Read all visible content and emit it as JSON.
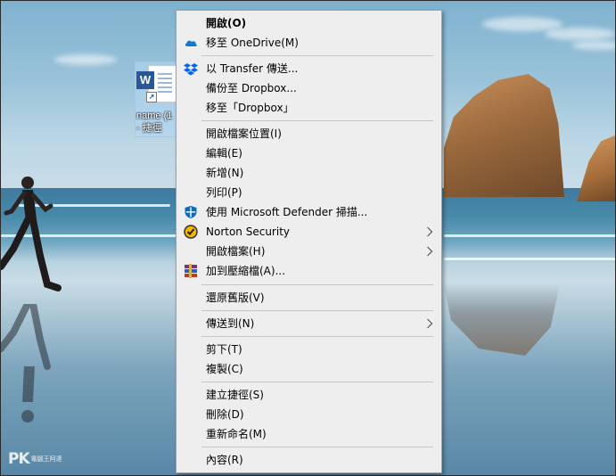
{
  "desktop": {
    "icon": {
      "badge": "W",
      "label_line1": "name (1",
      "label_line2": "- 捷徑"
    },
    "watermark": {
      "brand": "PK",
      "tagline": "電腦王阿達"
    }
  },
  "context_menu": {
    "items": [
      {
        "id": "open",
        "label": "開啟(O)",
        "bold": true,
        "icon": ""
      },
      {
        "id": "move-to-onedrive",
        "label": "移至 OneDrive(M)",
        "icon": "onedrive-cloud-icon"
      },
      {
        "id": "send-with-transfer",
        "label": "以 Transfer 傳送...",
        "icon": "dropbox-icon"
      },
      {
        "id": "backup-to-dropbox",
        "label": "備份至 Dropbox...",
        "icon": ""
      },
      {
        "id": "move-to-dropbox",
        "label": "移至「Dropbox」",
        "icon": ""
      },
      {
        "id": "open-file-location",
        "label": "開啟檔案位置(I)",
        "icon": ""
      },
      {
        "id": "edit",
        "label": "編輯(E)",
        "icon": ""
      },
      {
        "id": "new",
        "label": "新增(N)",
        "icon": ""
      },
      {
        "id": "print",
        "label": "列印(P)",
        "icon": ""
      },
      {
        "id": "scan-defender",
        "label": "使用 Microsoft Defender 掃描...",
        "icon": "defender-shield-icon"
      },
      {
        "id": "norton-security",
        "label": "Norton Security",
        "icon": "norton-check-icon",
        "submenu": true
      },
      {
        "id": "open-with",
        "label": "開啟檔案(H)",
        "icon": "",
        "submenu": true
      },
      {
        "id": "add-to-archive",
        "label": "加到壓縮檔(A)...",
        "icon": "winrar-books-icon"
      },
      {
        "id": "restore-previous",
        "label": "還原舊版(V)",
        "icon": ""
      },
      {
        "id": "send-to",
        "label": "傳送到(N)",
        "icon": "",
        "submenu": true
      },
      {
        "id": "cut",
        "label": "剪下(T)",
        "icon": ""
      },
      {
        "id": "copy",
        "label": "複製(C)",
        "icon": ""
      },
      {
        "id": "create-shortcut",
        "label": "建立捷徑(S)",
        "icon": ""
      },
      {
        "id": "delete",
        "label": "刪除(D)",
        "icon": ""
      },
      {
        "id": "rename",
        "label": "重新命名(M)",
        "icon": ""
      },
      {
        "id": "properties",
        "label": "內容(R)",
        "icon": ""
      }
    ]
  },
  "colors": {
    "menu_bg": "#eeeeee",
    "separator": "#c6c6c6",
    "onedrive": "#0f78d4",
    "dropbox": "#0061fe",
    "defender": "#0f6cbd",
    "norton": "#f5b800"
  }
}
